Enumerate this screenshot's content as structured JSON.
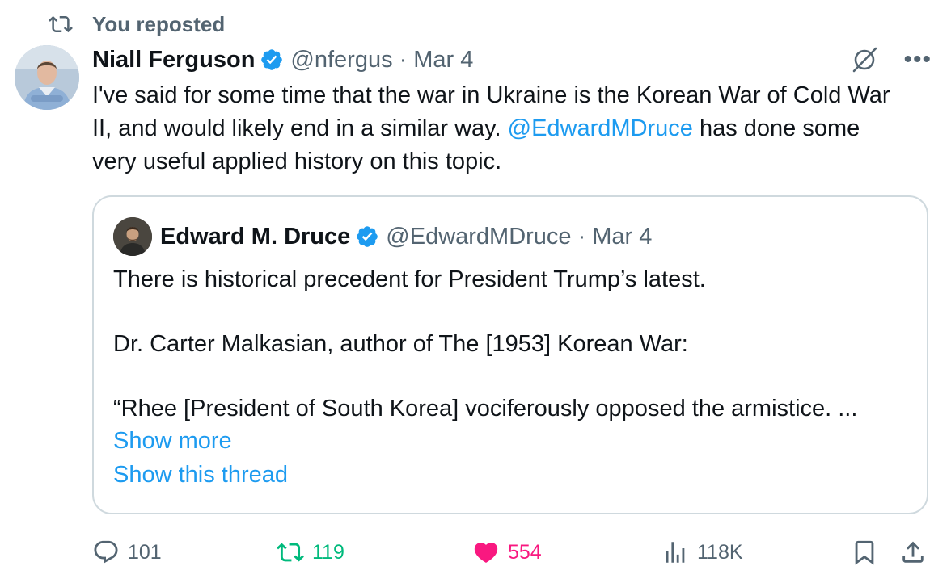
{
  "repost": {
    "label": "You reposted",
    "icon": "repost-icon"
  },
  "tweet": {
    "author_name": "Niall Ferguson",
    "handle": "@nfergus",
    "separator": "·",
    "date": "Mar 4",
    "text_part1": "I've said for some time that the war in Ukraine is the Korean War of Cold War II, and would likely end in a similar way. ",
    "mention": "@EdwardMDruce",
    "text_part2": " has done some very useful applied history on this topic."
  },
  "quote": {
    "author_name": "Edward M. Druce",
    "handle": "@EdwardMDruce",
    "separator": "·",
    "date": "Mar 4",
    "line1": "There is historical precedent for President Trump’s latest.",
    "line2": "Dr. Carter Malkasian, author of The [1953] Korean War:",
    "line3": "“Rhee [President of South Korea] vociferously opposed the armistice. ...",
    "show_more": "Show more",
    "show_thread": "Show this thread"
  },
  "actions": {
    "replies": "101",
    "reposts": "119",
    "likes": "554",
    "views": "118K"
  },
  "colors": {
    "accent": "#1d9bf0",
    "repost_active": "#00ba7c",
    "like_active": "#f91880",
    "muted": "#536471"
  }
}
